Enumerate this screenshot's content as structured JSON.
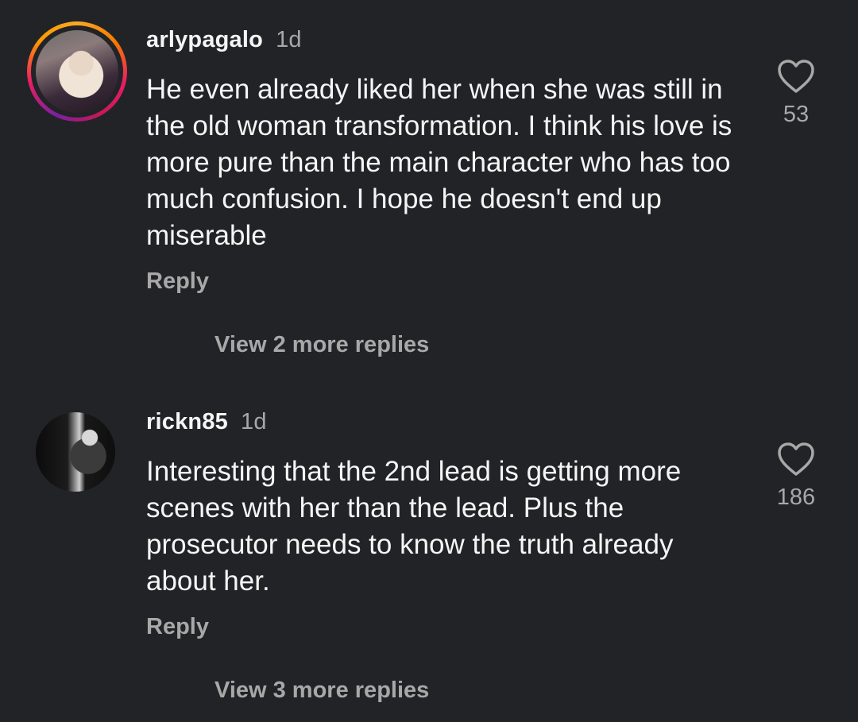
{
  "comments": [
    {
      "username": "arlypagalo",
      "timestamp": "1d",
      "text": "He even already liked her when she was still in the old woman transformation. I think his love is more pure than the main character who has too much confusion. I hope he doesn't end up miserable",
      "reply_label": "Reply",
      "view_more_label": "View 2 more replies",
      "like_count": "53",
      "avatar_has_story_ring": true,
      "icons": [
        "avatar",
        "heart-icon"
      ]
    },
    {
      "username": "rickn85",
      "timestamp": "1d",
      "text": "Interesting that the 2nd lead is getting more scenes with her than the lead. Plus the prosecutor needs to know the truth already about her.",
      "reply_label": "Reply",
      "view_more_label": "View 3 more replies",
      "like_count": "186",
      "avatar_has_story_ring": false,
      "icons": [
        "avatar",
        "heart-icon"
      ]
    }
  ],
  "colors": {
    "background": "#222326",
    "primary_text": "#f5f5f5",
    "secondary_text": "#a8a8a8",
    "story_ring": [
      "#f9a825",
      "#e91e63",
      "#7b1fa2"
    ]
  }
}
